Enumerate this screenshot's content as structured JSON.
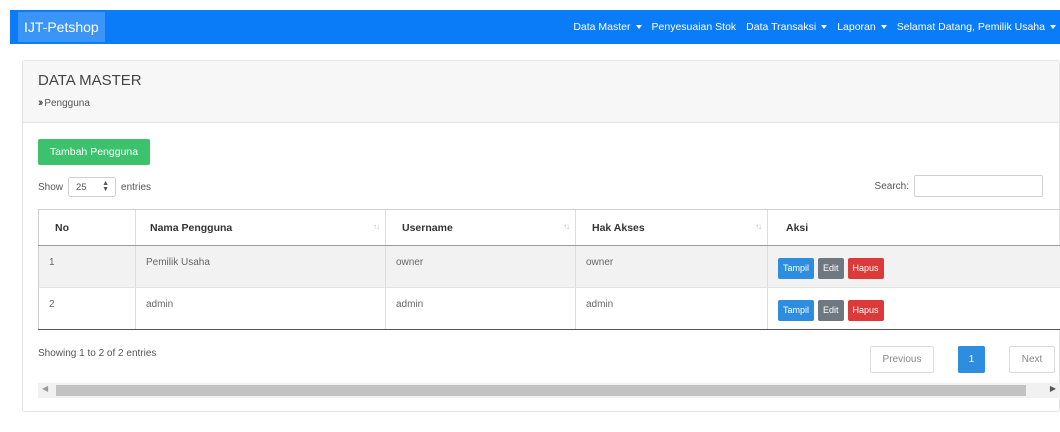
{
  "navbar": {
    "brand": "IJT-Petshop",
    "items": [
      {
        "label": "Data Master",
        "dropdown": true
      },
      {
        "label": "Penyesuaian Stok",
        "dropdown": false
      },
      {
        "label": "Data Transaksi",
        "dropdown": true
      },
      {
        "label": "Laporan",
        "dropdown": true
      },
      {
        "label": "Selamat Datang, Pemilik Usaha",
        "dropdown": true
      }
    ]
  },
  "page": {
    "title": "DATA MASTER",
    "breadcrumb_icon": "double-chevron-right-icon",
    "breadcrumb": "Pengguna"
  },
  "actions": {
    "add_label": "Tambah Pengguna"
  },
  "table_controls": {
    "show_label": "Show",
    "entries_value": "25",
    "entries_label": "entries",
    "search_label": "Search:",
    "search_value": ""
  },
  "table": {
    "columns": [
      "No",
      "Nama Pengguna",
      "Username",
      "Hak Akses",
      "Aksi"
    ],
    "rows": [
      {
        "no": "1",
        "nama": "Pemilik Usaha",
        "username": "owner",
        "hak_akses": "owner"
      },
      {
        "no": "2",
        "nama": "admin",
        "username": "admin",
        "hak_akses": "admin"
      }
    ],
    "row_buttons": {
      "view": "Tampil",
      "edit": "Edit",
      "delete": "Hapus"
    }
  },
  "footer": {
    "info": "Showing 1 to 2 of 2 entries",
    "prev": "Previous",
    "page": "1",
    "next": "Next"
  },
  "colors": {
    "navbar": "#0a7cf7",
    "add_button": "#3cc26c",
    "view_button": "#2e8ddf",
    "edit_button": "#6e7880",
    "delete_button": "#dc3a3a"
  }
}
